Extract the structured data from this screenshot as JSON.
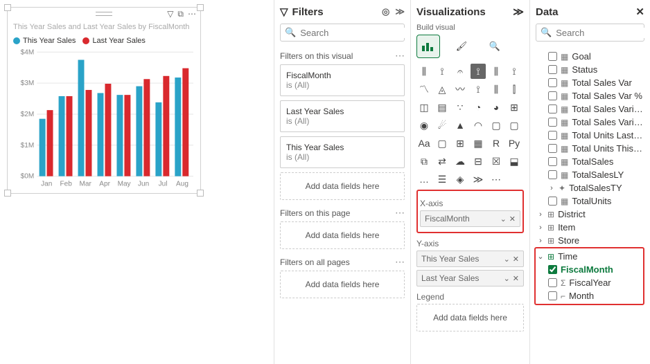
{
  "chart_data": {
    "type": "bar",
    "title": "This Year Sales and Last Year Sales by FiscalMonth",
    "series": [
      {
        "name": "This Year Sales",
        "color": "#2aa3c8",
        "values": [
          1850000,
          2580000,
          3750000,
          2680000,
          2620000,
          2900000,
          2380000,
          3180000
        ]
      },
      {
        "name": "Last Year Sales",
        "color": "#d9292e",
        "values": [
          2130000,
          2580000,
          2780000,
          2980000,
          2620000,
          3130000,
          3230000,
          3480000
        ]
      }
    ],
    "categories": [
      "Jan",
      "Feb",
      "Mar",
      "Apr",
      "May",
      "Jun",
      "Jul",
      "Aug"
    ],
    "ylabel": "",
    "yticks": [
      "$0M",
      "$1M",
      "$2M",
      "$3M",
      "$4M"
    ],
    "ylim": [
      0,
      4000000
    ]
  },
  "filters": {
    "title": "Filters",
    "search_ph": "Search",
    "visual_head": "Filters on this visual",
    "visual": [
      {
        "name": "FiscalMonth",
        "cond": "is (All)"
      },
      {
        "name": "Last Year Sales",
        "cond": "is (All)"
      },
      {
        "name": "This Year Sales",
        "cond": "is (All)"
      }
    ],
    "add": "Add data fields here",
    "page_head": "Filters on this page",
    "all_head": "Filters on all pages"
  },
  "viz": {
    "title": "Visualizations",
    "sub": "Build visual",
    "xaxis": {
      "label": "X-axis",
      "field": "FiscalMonth"
    },
    "yaxis": {
      "label": "Y-axis",
      "fields": [
        "This Year Sales",
        "Last Year Sales"
      ]
    },
    "legend": {
      "label": "Legend",
      "add": "Add data fields here"
    }
  },
  "data": {
    "title": "Data",
    "search_ph": "Search",
    "fields_top": [
      "Goal",
      "Status",
      "Total Sales Var",
      "Total Sales Var %",
      "Total Sales Vari…",
      "Total Sales Vari…",
      "Total Units Last…",
      "Total Units This…",
      "TotalSales",
      "TotalSalesLY"
    ],
    "totalSalesTY": "TotalSalesTY",
    "totalUnits": "TotalUnits",
    "tables": [
      "District",
      "Item",
      "Store"
    ],
    "time": {
      "name": "Time",
      "fields": [
        {
          "name": "FiscalMonth",
          "checked": true,
          "icon": "none"
        },
        {
          "name": "FiscalYear",
          "checked": false,
          "icon": "Σ"
        },
        {
          "name": "Month",
          "checked": false,
          "icon": "⌐"
        }
      ]
    }
  }
}
